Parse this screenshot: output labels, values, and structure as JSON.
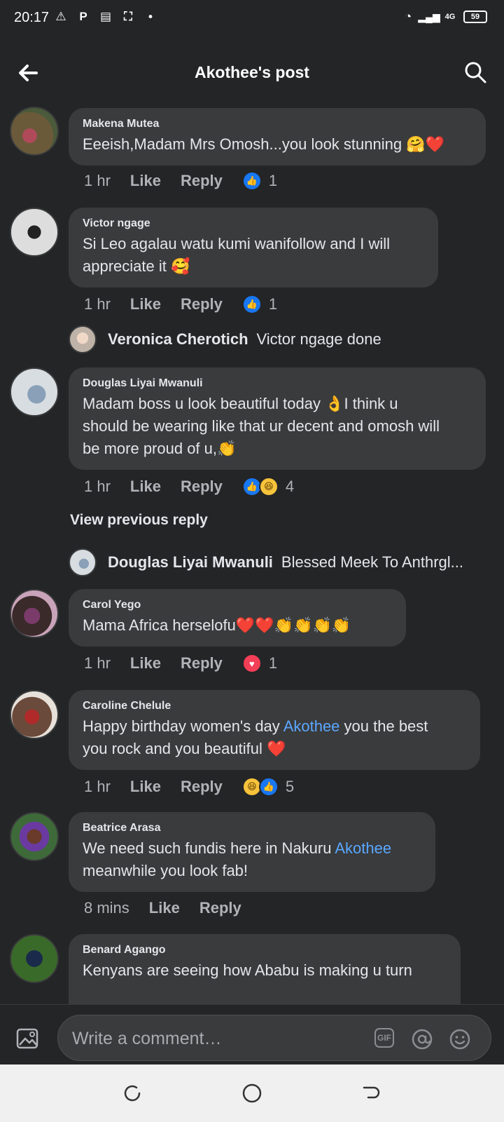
{
  "status_bar": {
    "time": "20:17",
    "network": "4G",
    "battery": "59"
  },
  "header": {
    "title": "Akothee's post"
  },
  "comments": [
    {
      "name": "Makena Mutea",
      "lines": [
        "Eeeish,Madam Mrs Omosh...you look stunning 🤗❤️"
      ],
      "time": "1 hr",
      "like": "Like",
      "reply": "Reply",
      "reactions": [
        "like"
      ],
      "count": "1"
    },
    {
      "name": "Victor ngage",
      "lines": [
        "Si Leo agalau watu kumi wanifollow and I will",
        "appreciate it 🥰"
      ],
      "time": "1 hr",
      "like": "Like",
      "reply": "Reply",
      "reactions": [
        "like"
      ],
      "count": "1"
    },
    {
      "name": "Douglas Liyai Mwanuli",
      "lines": [
        "Madam boss u look beautiful today 👌I think u",
        "should be wearing like that ur decent and omosh will",
        "be more proud of u,👏"
      ],
      "time": "1 hr",
      "like": "Like",
      "reply": "Reply",
      "reactions": [
        "like",
        "haha"
      ],
      "count": "4"
    },
    {
      "name": "Carol Yego",
      "lines": [
        "Mama Africa herselofu❤️❤️👏👏👏👏"
      ],
      "time": "1 hr",
      "like": "Like",
      "reply": "Reply",
      "reactions": [
        "love"
      ],
      "count": "1"
    },
    {
      "name": "Caroline Chelule",
      "line1_prefix": "Happy birthday women's day ",
      "mention": "Akothee",
      "line1_suffix": "  you the best",
      "line2": "you rock and you beautiful ❤️",
      "time": "1 hr",
      "like": "Like",
      "reply": "Reply",
      "reactions": [
        "haha",
        "like"
      ],
      "count": "5"
    },
    {
      "name": "Beatrice Arasa",
      "line1_prefix": "We need such fundis here in Nakuru ",
      "mention": "Akothee",
      "line2": "meanwhile you look fab!",
      "time": "8 mins",
      "like": "Like",
      "reply": "Reply"
    },
    {
      "name": "Benard Agango",
      "lines": [
        "Kenyans are seeing  how Ababu is making u turn"
      ]
    }
  ],
  "replies": [
    {
      "name": "Veronica Cherotich",
      "text": "Victor ngage done"
    },
    {
      "name": "Douglas Liyai Mwanuli",
      "text": "Blessed Meek To Anthrgl..."
    }
  ],
  "view_previous": "View previous reply",
  "composer": {
    "placeholder": "Write a comment…",
    "gif": "GIF"
  },
  "colors": {
    "background": "#242526",
    "bubble": "#3a3b3c",
    "mention": "#5aa7ff",
    "like_blue": "#1877f2",
    "love_red": "#f33e58",
    "haha_yellow": "#f7c33b"
  }
}
